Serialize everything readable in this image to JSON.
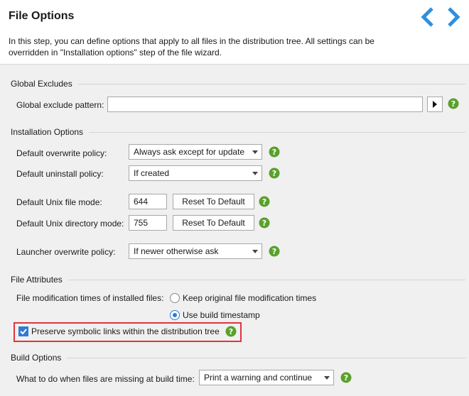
{
  "header": {
    "title": "File Options",
    "description": "In this step, you can define options that apply to all files in the distribution tree. All settings can be overridden in \"Installation options\" step of the file wizard."
  },
  "sections": {
    "global_excludes": "Global Excludes",
    "installation_options": "Installation Options",
    "file_attributes": "File Attributes",
    "build_options": "Build Options"
  },
  "global_excludes": {
    "pattern_label": "Global exclude pattern:",
    "pattern_value": ""
  },
  "installation": {
    "overwrite_label": "Default overwrite policy:",
    "overwrite_value": "Always ask except for update",
    "uninstall_label": "Default uninstall policy:",
    "uninstall_value": "If created",
    "unix_file_label": "Default Unix file mode:",
    "unix_file_value": "644",
    "unix_dir_label": "Default Unix directory mode:",
    "unix_dir_value": "755",
    "reset_label": "Reset To Default",
    "launcher_label": "Launcher overwrite policy:",
    "launcher_value": "If newer otherwise ask"
  },
  "file_attributes": {
    "mod_times_label": "File modification times of installed files:",
    "radio_keep": "Keep original file modification times",
    "radio_build": "Use build timestamp",
    "selected": "Use build timestamp",
    "symlinks_label": "Preserve symbolic links within the distribution tree",
    "symlinks_checked": true
  },
  "build": {
    "missing_label": "What to do when files are missing at build time:",
    "missing_value": "Print a warning and continue"
  },
  "colors": {
    "accent": "#2f7bd6",
    "help_green": "#5aa02c",
    "highlight": "#e0353d"
  }
}
